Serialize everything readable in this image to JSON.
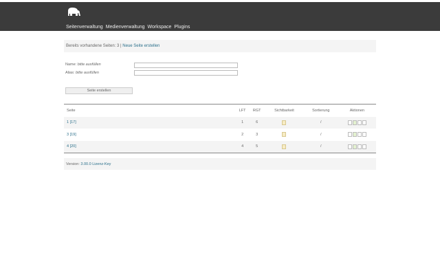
{
  "nav": [
    "Seitenverwaltung",
    "Medienverwaltung",
    "Workspace",
    "Plugins"
  ],
  "info": {
    "text": "Bereits vorhandene Seiten: 3 |",
    "link": "Neue Seite erstellen"
  },
  "form": {
    "name_label": "Name:",
    "name_hint": "bitte ausfüllen",
    "alias_label": "Alias:",
    "alias_hint": "bitte ausfüllen",
    "name_value": "",
    "alias_value": "",
    "submit": "Seite erstellen"
  },
  "table": {
    "headers": [
      "Seite",
      "LFT",
      "RGT",
      "Sichtbarkeit",
      "Sortierung",
      "Aktionen"
    ],
    "rows": [
      {
        "seite": "1 [17]",
        "lft": "1",
        "rgt": "6",
        "sort": "/"
      },
      {
        "seite": "3 [19]",
        "lft": "2",
        "rgt": "3",
        "sort": "/"
      },
      {
        "seite": "4 [20]",
        "lft": "4",
        "rgt": "5",
        "sort": "/"
      }
    ]
  },
  "footer": {
    "text": "Version:",
    "link": "3.00.0 Lizenz-Key"
  }
}
